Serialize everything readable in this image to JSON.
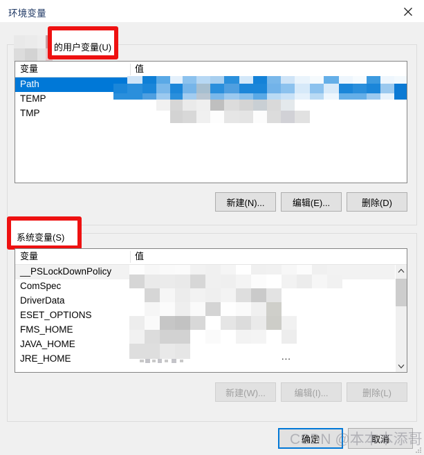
{
  "window": {
    "title": "环境变量",
    "close_icon": "close-icon",
    "title_color": "#1f3864"
  },
  "theme": {
    "accent": "#0078d7",
    "annotation_color": "#ee1111",
    "dialog_bg": "#f0f0f0",
    "list_bg": "#ffffff",
    "disabled_text": "#a0a0a0"
  },
  "user_section": {
    "legend": "的用户变量(U)",
    "legend_prefix_redacted": true,
    "columns": [
      "变量",
      "值"
    ],
    "rows": [
      {
        "name": "Path",
        "value_redacted": true,
        "selected": true
      },
      {
        "name": "TEMP",
        "value_redacted": true,
        "selected": false
      },
      {
        "name": "TMP",
        "value_redacted": true,
        "selected": false
      }
    ],
    "buttons": [
      {
        "label": "新建(N)...",
        "name": "new-user-variable-button",
        "disabled": false
      },
      {
        "label": "编辑(E)...",
        "name": "edit-user-variable-button",
        "disabled": false
      },
      {
        "label": "删除(D)",
        "name": "delete-user-variable-button",
        "disabled": false
      }
    ]
  },
  "system_section": {
    "legend": "系统变量(S)",
    "columns": [
      "变量",
      "值"
    ],
    "rows": [
      {
        "name": "__PSLockDownPolicy",
        "value_redacted": true,
        "hot": true
      },
      {
        "name": "ComSpec",
        "value_redacted": true,
        "hot": false
      },
      {
        "name": "DriverData",
        "value_redacted": true,
        "hot": false
      },
      {
        "name": "ESET_OPTIONS",
        "value_redacted": true,
        "hot": false
      },
      {
        "name": "FMS_HOME",
        "value_redacted": true,
        "hot": false
      },
      {
        "name": "JAVA_HOME",
        "value_redacted": true,
        "hot": false
      },
      {
        "name": "JRE_HOME",
        "value_redacted": true,
        "hot": false
      }
    ],
    "value_overflow_marker": "...",
    "scrollbar": {
      "up_icon": "chevron-up-icon",
      "down_icon": "chevron-down-icon",
      "thumb_position": "near-top"
    },
    "buttons": [
      {
        "label": "新建(W)...",
        "name": "new-system-variable-button",
        "disabled": true
      },
      {
        "label": "编辑(I)...",
        "name": "edit-system-variable-button",
        "disabled": true
      },
      {
        "label": "删除(L)",
        "name": "delete-system-variable-button",
        "disabled": true
      }
    ]
  },
  "dialog_buttons": {
    "ok": "确定",
    "cancel": "取消"
  },
  "watermark": {
    "text": "CSDN @本本本添哥"
  }
}
